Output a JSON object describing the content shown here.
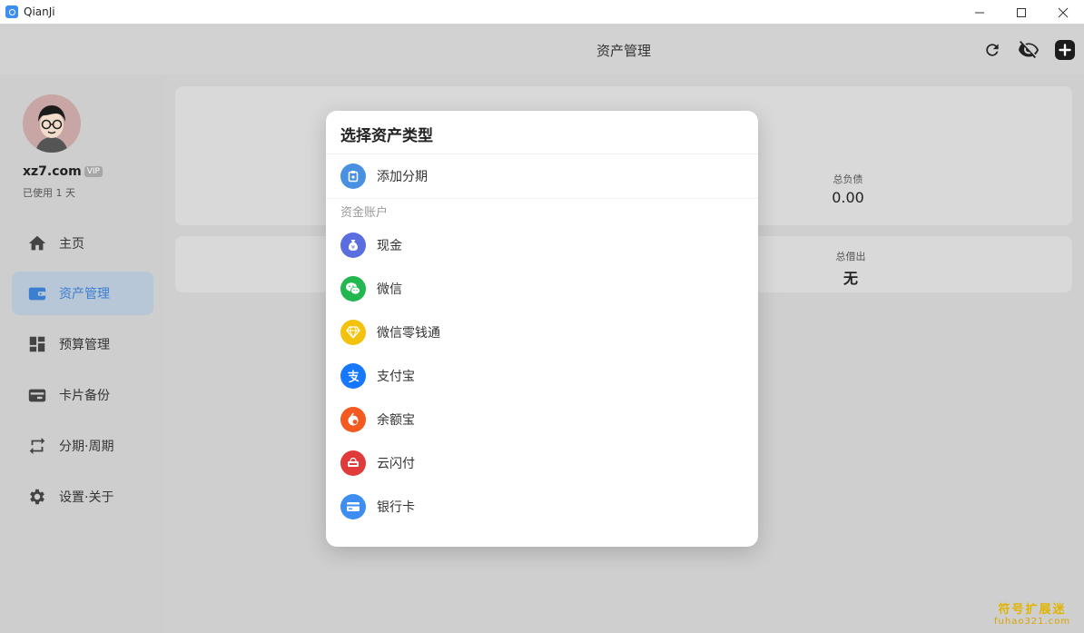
{
  "window": {
    "title": "QianJi"
  },
  "header": {
    "title": "资产管理"
  },
  "user": {
    "name": "xz7.com",
    "badge": "VIP",
    "usage": "已使用 1 天"
  },
  "sidebar": {
    "items": [
      {
        "label": "主页",
        "icon": "home-icon"
      },
      {
        "label": "资产管理",
        "icon": "wallet-icon",
        "active": true
      },
      {
        "label": "预算管理",
        "icon": "dashboard-icon"
      },
      {
        "label": "卡片备份",
        "icon": "card-icon"
      },
      {
        "label": "分期·周期",
        "icon": "repeat-icon"
      },
      {
        "label": "设置·关于",
        "icon": "gear-icon"
      }
    ]
  },
  "summary": {
    "total_liability_label": "总负债",
    "total_liability_value": "0.00",
    "total_lent_label": "总借出",
    "total_lent_value": "无"
  },
  "modal": {
    "title": "选择资产类型",
    "installment": {
      "label": "添加分期",
      "icon": "installment-icon",
      "color": "#4a90e2"
    },
    "section_label": "资金账户",
    "options": [
      {
        "label": "现金",
        "icon": "cash-bag-icon",
        "color": "#5b6ee0"
      },
      {
        "label": "微信",
        "icon": "wechat-icon",
        "color": "#22b84f"
      },
      {
        "label": "微信零钱通",
        "icon": "diamond-icon",
        "color": "#f4c20d"
      },
      {
        "label": "支付宝",
        "icon": "alipay-icon",
        "color": "#1677ff"
      },
      {
        "label": "余额宝",
        "icon": "yuebao-icon",
        "color": "#f25a1f"
      },
      {
        "label": "云闪付",
        "icon": "unionpay-icon",
        "color": "#e03a3a"
      },
      {
        "label": "银行卡",
        "icon": "bank-card-icon",
        "color": "#3d8ef0"
      }
    ]
  },
  "watermark": {
    "main": "符号扩展迷",
    "sub": "fuhao321.com"
  }
}
